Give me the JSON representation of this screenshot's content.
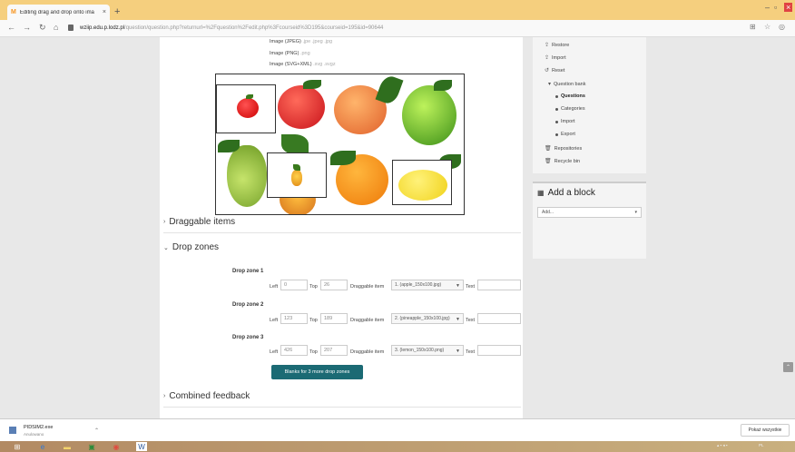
{
  "browser": {
    "tab_title": "Editing drag and drop onto ima",
    "tab_favicon": "moodle-icon",
    "url_host": "wziip.edu.p.lodz.pl",
    "url_path": "/question/question.php?returnurl=%2Fquestion%2Fedit.php%3Fcourseid%3D195&courseid=195&id=90644"
  },
  "file_types": {
    "jpeg": {
      "label": "Image (JPEG)",
      "ext": ".jpe .jpeg .jpg"
    },
    "png": {
      "label": "Image (PNG)",
      "ext": ".png"
    },
    "svg": {
      "label": "Image (SVG+XML)",
      "ext": ".svg .svgz"
    }
  },
  "sections": {
    "draggable_items": "Draggable items",
    "drop_zones": "Drop zones",
    "combined_feedback": "Combined feedback"
  },
  "drop_zone_fields": {
    "left_label": "Left",
    "top_label": "Top",
    "item_label": "Draggable item",
    "text_label": "Text"
  },
  "drop_zones": [
    {
      "title": "Drop zone 1",
      "left": "0",
      "top": "26",
      "item": "1. (apple_150x100.jpg)",
      "text": ""
    },
    {
      "title": "Drop zone 2",
      "left": "123",
      "top": "189",
      "item": "2. (pineapple_150x100.jpg)",
      "text": ""
    },
    {
      "title": "Drop zone 3",
      "left": "426",
      "top": "207",
      "item": "3. (lemon_150x100.png)",
      "text": ""
    }
  ],
  "blanks_button": "Blanks for 3 more drop zones",
  "sidebar": {
    "items": [
      {
        "label": "Restore",
        "icon": "restore-icon"
      },
      {
        "label": "Import",
        "icon": "import-icon"
      },
      {
        "label": "Reset",
        "icon": "reset-icon"
      },
      {
        "label": "Question bank",
        "icon": "caret-down-icon"
      },
      {
        "label": "Questions",
        "icon": "bullet-icon"
      },
      {
        "label": "Categories",
        "icon": "bullet-icon"
      },
      {
        "label": "Import",
        "icon": "bullet-icon"
      },
      {
        "label": "Export",
        "icon": "bullet-icon"
      },
      {
        "label": "Repositories",
        "icon": "trash-icon"
      },
      {
        "label": "Recycle bin",
        "icon": "trash-icon"
      }
    ],
    "add_block_title": "Add a block",
    "add_block_select": "Add..."
  },
  "download": {
    "file_name": "PIDSIM2.exe",
    "status": "Anulowano",
    "show_all": "Pokaż wszystkie"
  },
  "colors": {
    "tab_bar": "#f5cf7e",
    "button": "#1b6a74",
    "taskbar": "#b28a63"
  }
}
